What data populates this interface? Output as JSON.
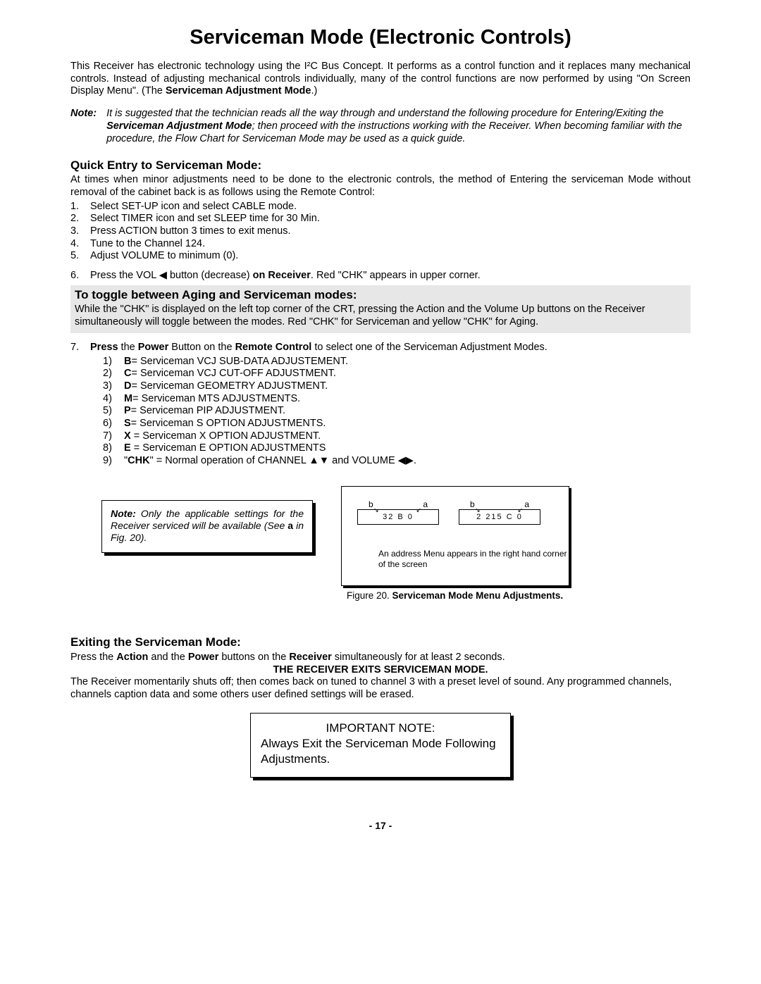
{
  "title": "Serviceman Mode (Electronic Controls)",
  "intro": "This Receiver has electronic technology using the I²C Bus Concept. It performs as a control function and it replaces many mechanical controls. Instead of adjusting mechanical controls individually, many of the control functions are now performed by using \"On Screen Display Menu\". (The ",
  "intro_b": "Serviceman Adjustment Mode",
  "intro_c": ".)",
  "note1_label": "Note:",
  "note1_a": "It is suggested that the technician reads all the way through and understand the following procedure for Entering/Exiting the ",
  "note1_b": "Serviceman Adjustment Mode",
  "note1_c": "; then proceed with the instructions working with the Receiver. When becoming familiar with the procedure, the Flow Chart for Serviceman Mode may be used as a quick guide.",
  "h_quick": "Quick Entry to Serviceman Mode:",
  "quick_intro": "At times when minor adjustments need to be done to the electronic controls, the method of Entering the serviceman Mode without removal of the cabinet back is as follows using the Remote Control:",
  "steps": {
    "s1": "Select SET-UP icon and select CABLE mode.",
    "s2": "Select TIMER icon and set SLEEP time for 30 Min.",
    "s3": "Press ACTION button 3 times to exit menus.",
    "s4": "Tune to the Channel 124.",
    "s5": "Adjust VOLUME to minimum (0).",
    "s6a": "Press the VOL ",
    "s6b": " button (decrease) ",
    "s6c": "on Receiver",
    "s6d": ". Red \"CHK\" appears in upper corner."
  },
  "toggle_title": "To toggle between Aging and Serviceman modes:",
  "toggle_body": "While the \"CHK\" is displayed on the left top corner of the CRT, pressing the Action and the Volume Up buttons on the Receiver simultaneously will toggle between the modes. Red \"CHK\" for Serviceman and yellow \"CHK\" for Aging.",
  "step7": {
    "a": "Press",
    "b": " the ",
    "c": "Power",
    "d": " Button on the ",
    "e": "Remote Control",
    "f": " to select one of the Serviceman Adjustment Modes."
  },
  "modes": {
    "m1": {
      "k": "B",
      "t": "= Serviceman VCJ SUB-DATA ADJUSTEMENT."
    },
    "m2": {
      "k": "C",
      "t": "= Serviceman VCJ CUT-OFF ADJUSTMENT."
    },
    "m3": {
      "k": "D",
      "t": "= Serviceman GEOMETRY ADJUSTMENT."
    },
    "m4": {
      "k": "M",
      "t": "= Serviceman MTS ADJUSTMENTS."
    },
    "m5": {
      "k": "P",
      "t": "= Serviceman PIP ADJUSTMENT."
    },
    "m6": {
      "k": "S",
      "t": "= Serviceman S OPTION ADJUSTMENTS."
    },
    "m7": {
      "k": "X ",
      "t": "= Serviceman X OPTION ADJUSTMENT."
    },
    "m8": {
      "k": "E ",
      "t": "= Serviceman E OPTION ADJUSTMENTS"
    },
    "m9a": "\"",
    "m9b": "CHK",
    "m9c": "\" = Normal operation of CHANNEL ",
    "m9d": " and VOLUME ",
    "m9e": "."
  },
  "small_note": {
    "a": "Note:",
    "b": " Only the applicable settings for the Receiver serviced will be available (See ",
    "c": "a",
    "d": " in Fig. 20)."
  },
  "fig": {
    "cell1_b": "b",
    "cell1_a": "a",
    "cell1_val": "32  B  0",
    "cell2_b": "b",
    "cell2_a": "a",
    "cell2_val": "2  215  C  0",
    "caption": "An address Menu appears in the right hand corner of the screen",
    "label": "Figure 20.  ",
    "label_b": "Serviceman Mode Menu Adjustments."
  },
  "h_exit": "Exiting the Serviceman Mode:",
  "exit_a": "Press the ",
  "exit_b": "Action",
  "exit_c": " and the ",
  "exit_d": "Power",
  "exit_e": " buttons on the ",
  "exit_f": "Receiver",
  "exit_g": " simultaneously for at least 2 seconds.",
  "exit_bold": "THE RECEIVER EXITS SERVICEMAN MODE.",
  "exit_p2": "The Receiver momentarily shuts off; then comes back on tuned to channel 3 with a preset level of sound. Any programmed channels, channels caption data and some others user defined settings will be erased.",
  "important_title": "IMPORTANT NOTE:",
  "important_body": "Always Exit the Serviceman Mode Following Adjustments.",
  "pagenum": "- 17 -",
  "glyph": {
    "left": "◀",
    "right": "▶",
    "up": "▲",
    "down": "▼",
    "ne": "↘",
    "nw": "↙"
  }
}
